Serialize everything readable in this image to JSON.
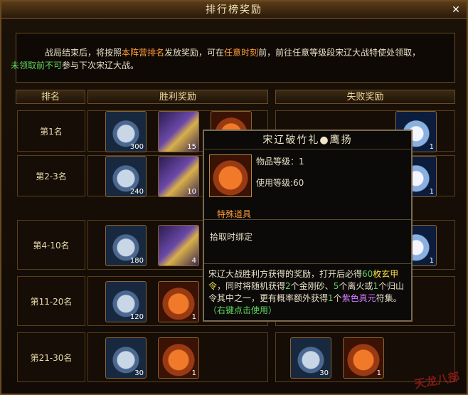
{
  "window": {
    "title": "排行榜奖励"
  },
  "intro": {
    "p1": "战局结束后，将按照",
    "p2": "本阵营排名",
    "p3": "发放奖励，可在",
    "p4": "任意时刻",
    "p5": "前，前往任意等级段宋辽大战特使处领取，",
    "p6": "未领取前不可",
    "p7": "参与下次宋辽大战。"
  },
  "headers": {
    "rank": "排名",
    "win": "胜利奖励",
    "lose": "失败奖励"
  },
  "rows": [
    {
      "rank": "第1名",
      "win": [
        "300",
        "15",
        ""
      ],
      "lose": [
        "",
        "",
        "1"
      ]
    },
    {
      "rank": "第2-3名",
      "win": [
        "240",
        "10",
        ""
      ],
      "lose": [
        "",
        "",
        "1"
      ]
    },
    {
      "rank": "第4-10名",
      "win": [
        "180",
        "4",
        ""
      ],
      "lose": [
        "",
        "",
        "1"
      ]
    },
    {
      "rank": "第11-20名",
      "win": [
        "120",
        "1",
        ""
      ],
      "lose": [
        "",
        "",
        ""
      ]
    },
    {
      "rank": "第21-30名",
      "win": [
        "30",
        "1",
        ""
      ],
      "lose": [
        "30",
        "1",
        ""
      ]
    }
  ],
  "tooltip": {
    "title": "宋辽破竹礼●鹰扬",
    "item_level": "物品等级：1",
    "use_level": "使用等级:60",
    "type": "特殊道具",
    "bind": "拾取时绑定",
    "d1": "宋辽大战胜利方获得的奖励，打开后必得",
    "d2": "60",
    "d3": "枚玄甲令",
    "d4": "，同时将随机获得",
    "d5": "2",
    "d6": "个金刚砂、",
    "d7": "5",
    "d8": "个离火或",
    "d9": "1",
    "d10": "个归山令其中之一，更有概率额外获得",
    "d11": "1",
    "d12": "个",
    "d13": "紫色真元",
    "d14": "符集。",
    "hint": "（右键点击使用）"
  },
  "watermark": "天龙八部",
  "colors": {
    "accent_orange": "#ff9a3a",
    "accent_green": "#5fd35f"
  }
}
